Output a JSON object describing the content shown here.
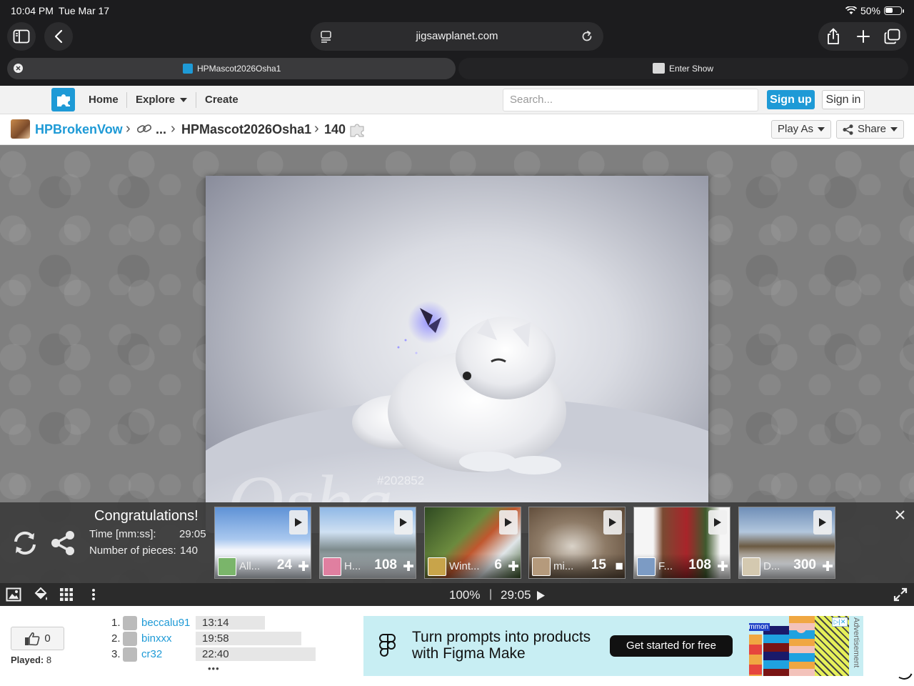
{
  "status_bar": {
    "time": "10:04 PM",
    "date": "Tue Mar 17",
    "battery": "50%"
  },
  "browser": {
    "url": "jigsawplanet.com",
    "tabs": [
      {
        "label": "HPMascot2026Osha1",
        "active": true
      },
      {
        "label": "Enter Show",
        "active": false
      }
    ]
  },
  "site_nav": {
    "items": [
      "Home",
      "Explore",
      "Create"
    ],
    "search_placeholder": "Search...",
    "signup": "Sign up",
    "signin": "Sign in",
    "accent": "#1e9ad6"
  },
  "breadcrumb": {
    "user": "HPBrokenVow",
    "ellipsis": "...",
    "puzzle": "HPMascot2026Osha1",
    "pieces": "140",
    "play_as": "Play As",
    "share": "Share"
  },
  "image_overlay": {
    "watermark_tag": "#202852",
    "script_text": "Osha"
  },
  "congrats": {
    "title": "Congratulations!",
    "time_label": "Time [mm:ss]:",
    "time_value": "29:05",
    "pieces_label": "Number of pieces:",
    "pieces_value": "140",
    "suggestions": [
      {
        "name": "All...",
        "count": "24"
      },
      {
        "name": "H...",
        "count": "108"
      },
      {
        "name": "Wint...",
        "count": "6"
      },
      {
        "name": "mi...",
        "count": "15"
      },
      {
        "name": "F...",
        "count": "108"
      },
      {
        "name": "D...",
        "count": "300"
      }
    ]
  },
  "toolbar": {
    "zoom": "100%",
    "separator": "|",
    "timer": "29:05"
  },
  "footer": {
    "likes": "0",
    "played_label": "Played:",
    "played_value": "8",
    "leaderboard": [
      {
        "rank": "1.",
        "name": "beccalu91",
        "time": "13:14",
        "fill": 0.58
      },
      {
        "rank": "2.",
        "name": "binxxx",
        "time": "19:58",
        "fill": 0.88
      },
      {
        "rank": "3.",
        "name": "cr32",
        "time": "22:40",
        "fill": 1.0
      }
    ],
    "more": "•••"
  },
  "ad": {
    "line1": "Turn prompts into products",
    "line2": "with Figma Make",
    "cta": "Get started for free",
    "tag": "/common",
    "label": "Advertisement"
  }
}
